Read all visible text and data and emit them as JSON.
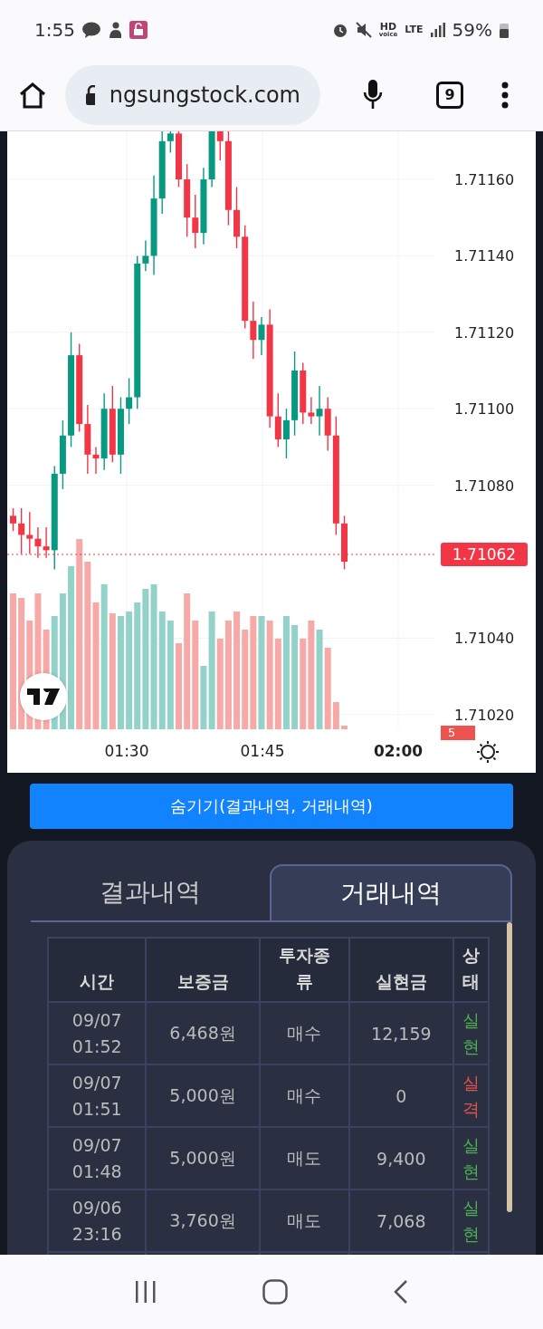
{
  "status_bar": {
    "time": "1:55",
    "voice": "HD",
    "voice_sub": "voice",
    "network": "LTE",
    "battery": "59%"
  },
  "browser": {
    "url": "ngsungstock.com",
    "tab_count": "9"
  },
  "chart": {
    "price_labels": [
      "1.71160",
      "1.71140",
      "1.71120",
      "1.71100",
      "1.71080",
      "1.71040",
      "1.71020"
    ],
    "last_price": "1.71062",
    "volume_badge": "5",
    "time_labels": [
      {
        "label": "01:30",
        "bold": false
      },
      {
        "label": "01:45",
        "bold": false
      },
      {
        "label": "02:00",
        "bold": true
      }
    ]
  },
  "toggle_button": "숨기기(결과내역, 거래내역)",
  "tabs": [
    {
      "label": "결과내역",
      "selected": false
    },
    {
      "label": "거래내역",
      "selected": true
    }
  ],
  "table": {
    "columns": [
      "시간",
      "보증금",
      "투자종류",
      "실현금",
      "상태"
    ],
    "rows": [
      {
        "time": "09/07 01:52",
        "margin": "6,468원",
        "type": "매수",
        "realized": "12,159",
        "status": "실현",
        "kind": "win"
      },
      {
        "time": "09/07 01:51",
        "margin": "5,000원",
        "type": "매수",
        "realized": "0",
        "status": "실격",
        "kind": "loss"
      },
      {
        "time": "09/07 01:48",
        "margin": "5,000원",
        "type": "매도",
        "realized": "9,400",
        "status": "실현",
        "kind": "win"
      },
      {
        "time": "09/06 23:16",
        "margin": "3,760원",
        "type": "매도",
        "realized": "7,068",
        "status": "실현",
        "kind": "win"
      }
    ]
  }
}
